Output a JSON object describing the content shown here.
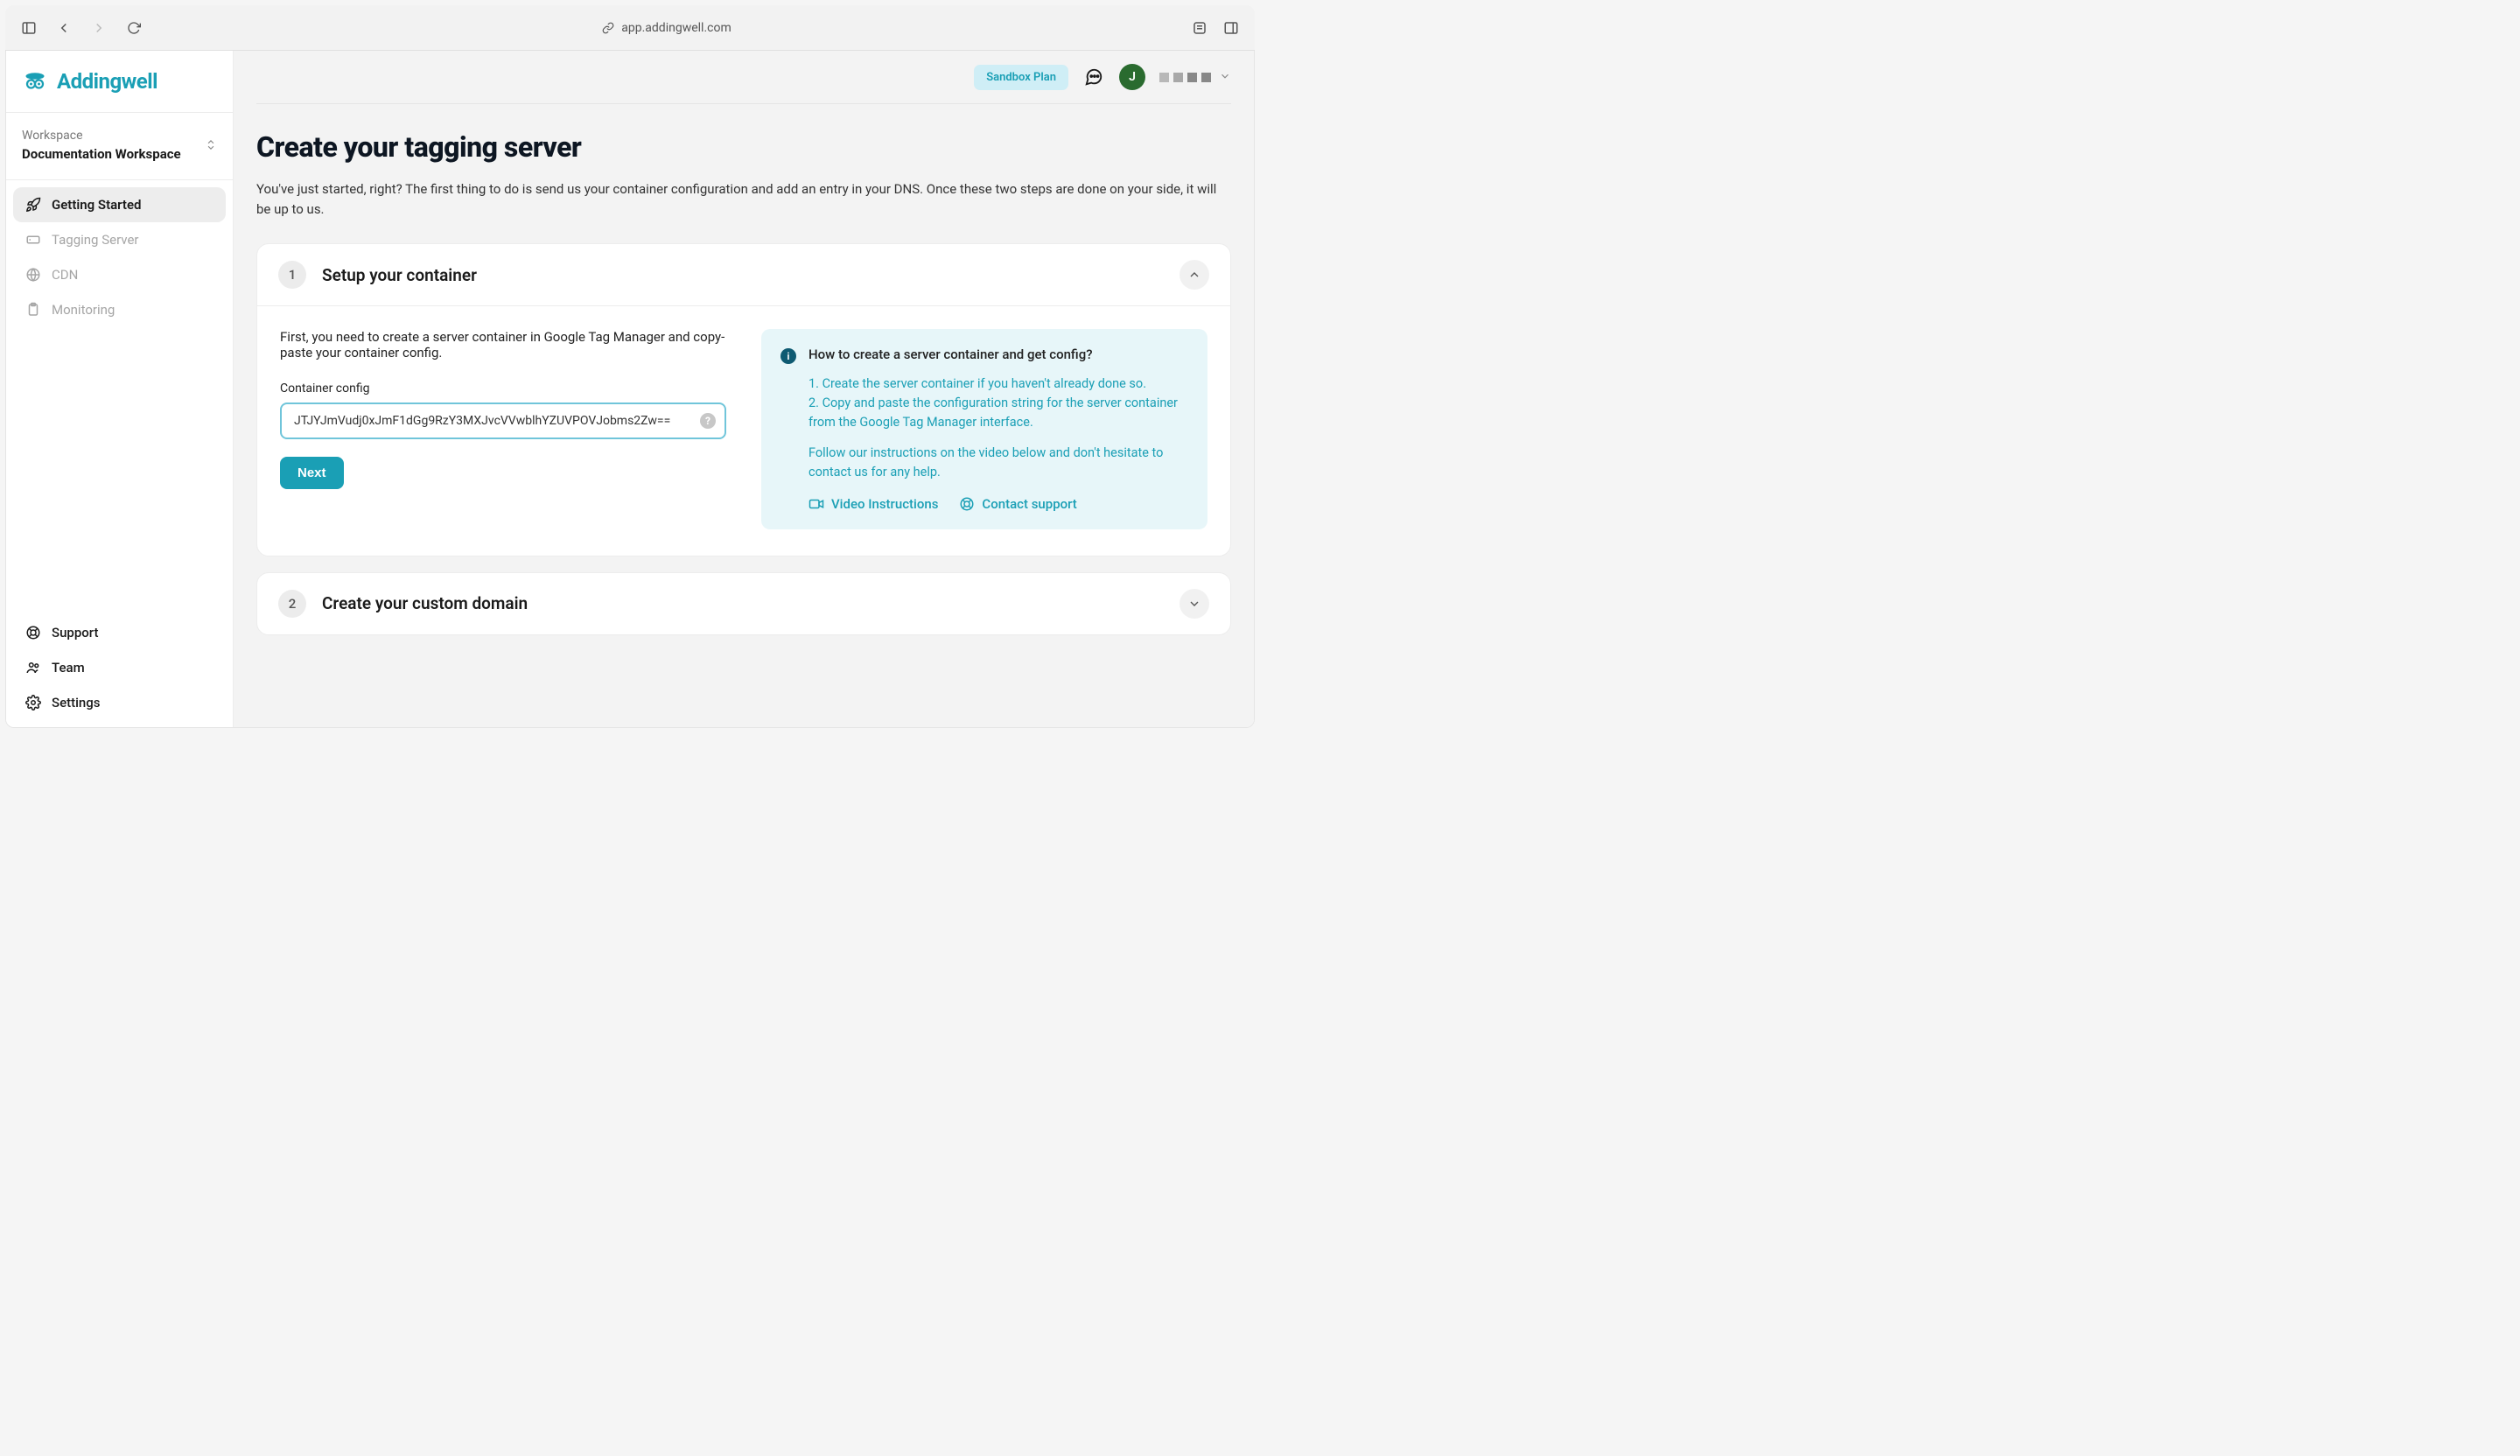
{
  "browser": {
    "url": "app.addingwell.com"
  },
  "brand": {
    "name": "Addingwell",
    "accent": "#1a9fb5"
  },
  "workspace": {
    "label": "Workspace",
    "name": "Documentation Workspace"
  },
  "sidebar": {
    "items": [
      {
        "label": "Getting Started",
        "icon": "rocket-icon",
        "active": true
      },
      {
        "label": "Tagging Server",
        "icon": "server-icon",
        "active": false
      },
      {
        "label": "CDN",
        "icon": "globe-icon",
        "active": false
      },
      {
        "label": "Monitoring",
        "icon": "clipboard-icon",
        "active": false
      }
    ],
    "footer": [
      {
        "label": "Support",
        "icon": "support-icon"
      },
      {
        "label": "Team",
        "icon": "team-icon"
      },
      {
        "label": "Settings",
        "icon": "settings-icon"
      }
    ]
  },
  "topbar": {
    "plan_badge": "Sandbox Plan",
    "avatar_initial": "J"
  },
  "page": {
    "title": "Create your tagging server",
    "description": "You've just started, right? The first thing to do is send us your container configuration and add an entry in your DNS. Once these two steps are done on your side, it will be up to us."
  },
  "steps": [
    {
      "number": "1",
      "title": "Setup your container",
      "expanded": true,
      "instruction": "First, you need to create a server container in Google Tag Manager and copy-paste your container config.",
      "field_label": "Container config",
      "field_value": "JTJYJmVudj0xJmF1dGg9RzY3MXJvcVVwblhYZUVPOVJobms2Zw==",
      "next_label": "Next",
      "info": {
        "title": "How to create a server container and get config?",
        "body_line1": "1. Create the server container if you haven't already done so.",
        "body_line2": "2. Copy and paste the configuration string for the server container from the Google Tag Manager interface.",
        "body_line3": "Follow our instructions on the video below and don't hesitate to contact us for any help.",
        "video_link": "Video Instructions",
        "contact_link": "Contact support"
      }
    },
    {
      "number": "2",
      "title": "Create your custom domain",
      "expanded": false
    }
  ]
}
